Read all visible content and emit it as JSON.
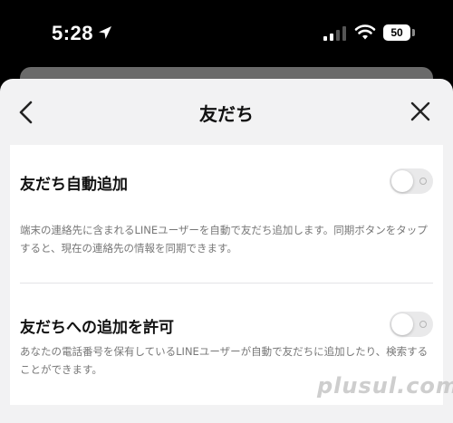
{
  "status_bar": {
    "time": "5:28",
    "battery": "50",
    "location_icon": "location-arrow-icon",
    "signal_icon": "cellular-signal-icon",
    "wifi_icon": "wifi-icon"
  },
  "sheet": {
    "title": "友だち",
    "back_icon": "chevron-left-icon",
    "close_icon": "close-icon"
  },
  "settings": [
    {
      "title": "友だち自動追加",
      "description_lines": [
        "端末の連絡先に含まれるLINEユーザーを自動で友だち追加します。同期ボタンをタップ",
        "すると、現在の連絡先の情報を同期できます。"
      ],
      "enabled": false
    },
    {
      "title": "友だちへの追加を許可",
      "description_lines": [
        "あなたの電話番号を保有しているLINEユーザーが自動で友だちに追加したり、検索する",
        "ことができます。"
      ],
      "enabled": false
    }
  ],
  "watermark": "plusul.com",
  "colors": {
    "toggle_off": "#e9e9ea",
    "sheet_bg": "#f2f2f3",
    "content_bg": "#ffffff"
  }
}
